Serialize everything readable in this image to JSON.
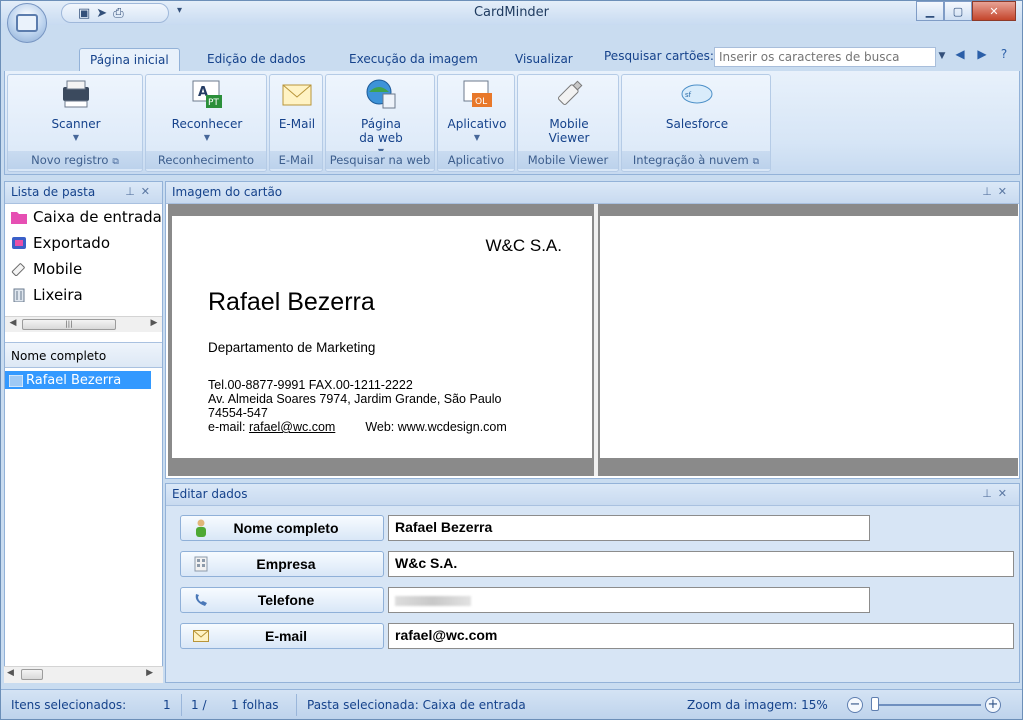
{
  "window": {
    "title": "CardMinder"
  },
  "tabs": [
    "Página inicial",
    "Edição de dados",
    "Execução da imagem",
    "Visualizar"
  ],
  "search": {
    "label": "Pesquisar cartões:",
    "placeholder": "Inserir os caracteres de busca"
  },
  "ribbon": {
    "buttons": {
      "scanner": "Scanner",
      "reconhecer": "Reconhecer",
      "email": "E-Mail",
      "web_line1": "Página",
      "web_line2": "da web",
      "aplicativo": "Aplicativo",
      "mobile_line1": "Mobile",
      "mobile_line2": "Viewer",
      "salesforce": "Salesforce"
    },
    "groups": {
      "novo_registro": "Novo registro",
      "reconhecimento": "Reconhecimento",
      "email": "E-Mail",
      "pesquisar_web": "Pesquisar na web",
      "aplicativo": "Aplicativo",
      "mobile_viewer": "Mobile Viewer",
      "integracao": "Integração à nuvem"
    }
  },
  "folder_panel": {
    "title": "Lista de pasta",
    "folders": [
      "Caixa de entrada",
      "Exportado",
      "Mobile",
      "Lixeira"
    ],
    "list_header": "Nome completo",
    "selected_item": "Rafael Bezerra"
  },
  "card_panel": {
    "title": "Imagem do cartão",
    "card": {
      "company": "W&C S.A.",
      "name": "Rafael Bezerra",
      "department": "Departamento de Marketing",
      "tel_fax": "Tel.00-8877-9991   FAX.00-1211-2222",
      "address_line1": "Av. Almeida Soares 7974, Jardim Grande, São Paulo",
      "address_line2": "74554-547",
      "email_prefix": "e-mail: ",
      "email": "rafael@wc.com",
      "web": "Web: www.wcdesign.com"
    }
  },
  "edit_panel": {
    "title": "Editar dados",
    "fields": {
      "nome_label": "Nome completo",
      "nome_value": "Rafael Bezerra",
      "empresa_label": "Empresa",
      "empresa_value": "W&c S.A.",
      "telefone_label": "Telefone",
      "email_label": "E-mail",
      "email_value": "rafael@wc.com"
    }
  },
  "status": {
    "selected_label": "Itens selecionados:",
    "selected_count": "1",
    "page": "1 /",
    "sheets": "1 folhas",
    "folder": "Pasta selecionada: Caixa de entrada",
    "zoom_label": "Zoom da imagem: 15%",
    "zoom_level_percent": 15
  },
  "colors": {
    "accent": "#15428b",
    "selection": "#3399ff",
    "ribbon_bg": "#dbe8f7"
  }
}
